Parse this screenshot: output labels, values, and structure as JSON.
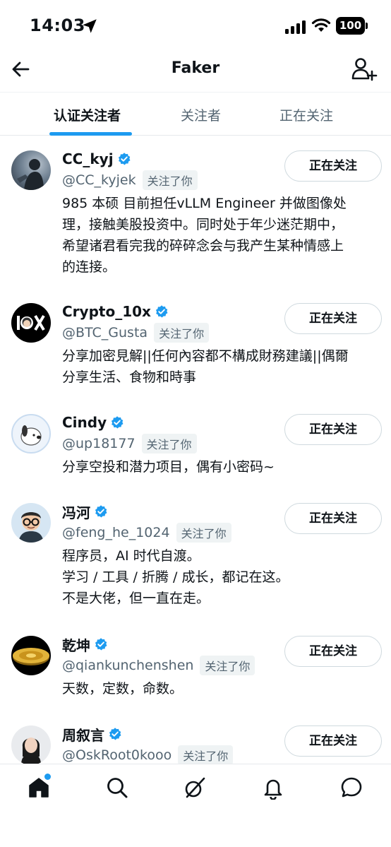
{
  "status_bar": {
    "time": "14:03",
    "battery": "100",
    "icons": [
      "location-arrow-icon",
      "cellular-signal-icon",
      "wifi-icon",
      "battery-icon"
    ]
  },
  "header": {
    "title": "Faker",
    "back_icon": "arrow-left-icon",
    "action_icon": "person-add-icon"
  },
  "tabs": [
    {
      "label": "认证关注者",
      "active": true
    },
    {
      "label": "关注者",
      "active": false
    },
    {
      "label": "正在关注",
      "active": false
    }
  ],
  "colors": {
    "accent": "#1d9bf0",
    "text_primary": "#0f1419",
    "text_secondary": "#536471",
    "badge_bg": "#eff3f4",
    "border": "#cfd9de"
  },
  "users": [
    {
      "name": "CC_kyj",
      "handle": "@CC_kyjek",
      "follows_you": "关注了你",
      "button": "正在关注",
      "verified": true,
      "bio_lines": [
        "985 本硕 目前担任vLLM Engineer 并做图像处",
        "理，接触美股投资中。同时处于年少迷茫期中，",
        "希望诸君看完我的碎碎念会与我产生某种情感上",
        "的连接。"
      ]
    },
    {
      "name": "Crypto_10x",
      "handle": "@BTC_Gusta",
      "follows_you": "关注了你",
      "button": "正在关注",
      "verified": true,
      "bio_lines": [
        "分享加密見解||任何內容都不構成財務建議||偶爾",
        "分享生活、食物和時事"
      ]
    },
    {
      "name": "Cindy",
      "handle": "@up18177",
      "follows_you": "关注了你",
      "button": "正在关注",
      "verified": true,
      "bio_lines": [
        "分享空投和潜力项目，偶有小密码~"
      ]
    },
    {
      "name": "冯河",
      "handle": "@feng_he_1024",
      "follows_you": "关注了你",
      "button": "正在关注",
      "verified": true,
      "bio_lines": [
        "程序员，AI 时代自渡。",
        "学习 / 工具 / 折腾 / 成长，都记在这。",
        "不是大佬，但一直在走。"
      ]
    },
    {
      "name": "乾坤",
      "handle": "@qiankunchenshen",
      "follows_you": "关注了你",
      "button": "正在关注",
      "verified": true,
      "bio_lines": [
        "天数，定数，命数。"
      ]
    },
    {
      "name": "周叙言",
      "handle": "@OskRoot0kooo",
      "follows_you": "关注了你",
      "button": "正在关注",
      "verified": true,
      "bio_lines": []
    }
  ],
  "bottom_nav": {
    "items": [
      "home-icon",
      "search-icon",
      "grok-icon",
      "bell-icon",
      "message-icon"
    ],
    "home_has_badge": true
  }
}
